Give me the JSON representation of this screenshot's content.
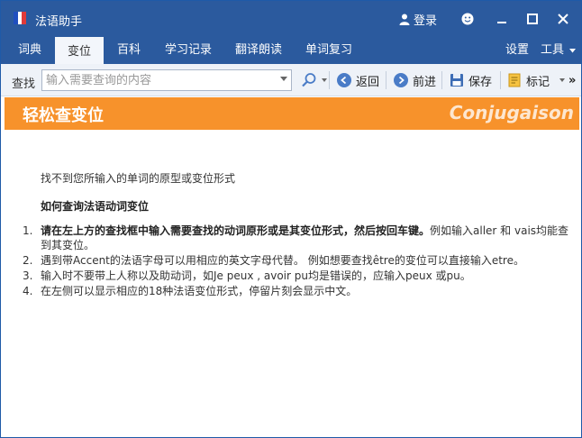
{
  "app": {
    "title": "法语助手",
    "flag_colors": [
      "#1f4fbf",
      "#ffffff",
      "#e03a3a"
    ]
  },
  "titlebar": {
    "login_label": "登录",
    "login_icon": "user-icon",
    "buttons": [
      "smiley-icon",
      "minimize-icon",
      "maximize-icon",
      "close-icon"
    ]
  },
  "tabs": [
    {
      "label": "词典",
      "active": false
    },
    {
      "label": "变位",
      "active": true
    },
    {
      "label": "百科",
      "active": false
    },
    {
      "label": "学习记录",
      "active": false
    },
    {
      "label": "翻译朗读",
      "active": false
    },
    {
      "label": "单词复习",
      "active": false
    }
  ],
  "tabs_right": {
    "settings": "设置",
    "tools": "工具"
  },
  "toolbar": {
    "search_label": "查找",
    "search_placeholder": "输入需要查询的内容",
    "back": "返回",
    "forward": "前进",
    "save": "保存",
    "mark": "标记",
    "more": "»"
  },
  "banner": {
    "title": "轻松查变位",
    "subtitle": "Conjugaison",
    "color": "#f7922b"
  },
  "content": {
    "not_found": "找不到您所输入的单词的原型或变位形式",
    "how_title": "如何查询法语动词变位",
    "steps": [
      {
        "num": "1.",
        "bold": "请在左上方的查找框中输入需要查找的动词原形或是其变位形式，然后按回车键。",
        "text": "例如输入aller 和 vais均能查到其变位。"
      },
      {
        "num": "2.",
        "bold": "",
        "text": "遇到带Accent的法语字母可以用相应的英文字母代替。 例如想要查找être的变位可以直接输入etre。"
      },
      {
        "num": "3.",
        "bold": "",
        "text": "输入时不要带上人称以及助动词，如Je peux , avoir pu均是错误的，应输入peux 或pu。"
      },
      {
        "num": "4.",
        "bold": "",
        "text": "在左侧可以显示相应的18种法语变位形式，停留片刻会显示中文。"
      }
    ]
  }
}
